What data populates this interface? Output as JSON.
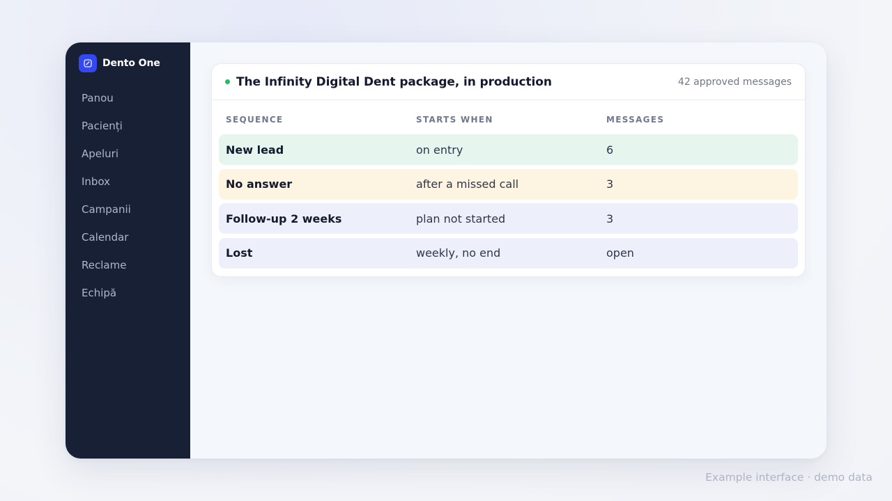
{
  "sidebar": {
    "brand": "Dento One",
    "items": [
      {
        "label": "Panou"
      },
      {
        "label": "Pacienți"
      },
      {
        "label": "Apeluri"
      },
      {
        "label": "Inbox"
      },
      {
        "label": "Campanii"
      },
      {
        "label": "Calendar"
      },
      {
        "label": "Reclame"
      },
      {
        "label": "Echipă"
      }
    ]
  },
  "card": {
    "title": "The Infinity Digital Dent package, in production",
    "count": "42 approved messages",
    "status_color": "#1fbf63",
    "columns": [
      "SEQUENCE",
      "STARTS WHEN",
      "MESSAGES"
    ],
    "rows": [
      {
        "name": "New lead",
        "starts": "on entry",
        "messages": "6",
        "color": "#e6f6ee"
      },
      {
        "name": "No answer",
        "starts": "after a missed call",
        "messages": "3",
        "color": "#fdf5e1"
      },
      {
        "name": "Follow-up 2 weeks",
        "starts": "plan not started",
        "messages": "3",
        "color": "#edf0fb"
      },
      {
        "name": "Lost",
        "starts": "weekly, no end",
        "messages": "open",
        "color": "#edf0fb"
      }
    ]
  },
  "footer": {
    "note": "Example interface · demo data"
  },
  "colors": {
    "sidebar_bg": "#182036",
    "accent": "#3348f0"
  }
}
